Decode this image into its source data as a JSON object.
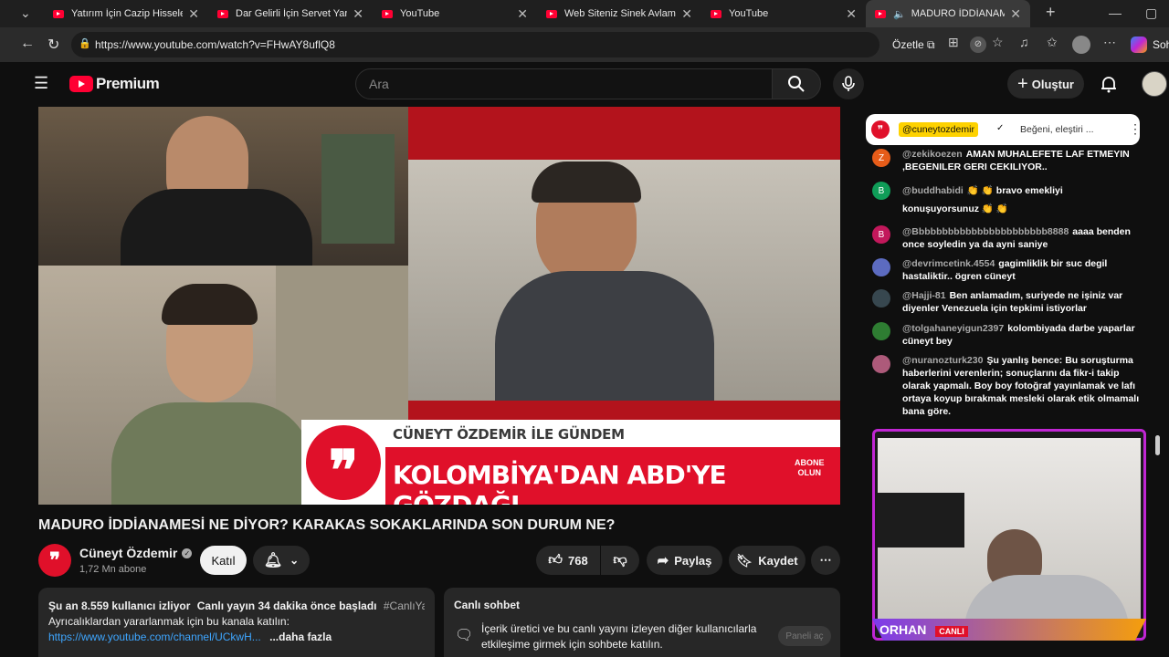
{
  "browser": {
    "tabs": [
      {
        "title": "Yatırım İçin Cazip Hisseler Oc"
      },
      {
        "title": "Dar Gelirli İçin Servet Yaratma"
      },
      {
        "title": "YouTube"
      },
      {
        "title": "Web Siteniz Sinek Avlamasını"
      },
      {
        "title": "YouTube"
      },
      {
        "title": "MADURO İDDİANAMESİ"
      }
    ],
    "url": "https://www.youtube.com/watch?v=FHwAY8uflQ8",
    "summarize_label": "Özetle",
    "copilot_label": "Soh"
  },
  "youtube": {
    "logo_text": "Premium",
    "search_placeholder": "Ara",
    "create_label": "Oluştur"
  },
  "video": {
    "show_name": "CÜNEYT ÖZDEMİR İLE GÜNDEM",
    "headline": "KOLOMBİYA'DAN ABD'YE GÖZDAĞI",
    "subscribe_badge_line1": "ABONE",
    "subscribe_badge_line2": "OLUN",
    "title": "MADURO İDDİANAMESİ NE DİYOR? KARAKAS SOKAKLARINDA SON DURUM NE?"
  },
  "channel": {
    "name": "Cüneyt Özdemir",
    "subscribers": "1,72 Mn abone",
    "join_label": "Katıl"
  },
  "actions": {
    "likes": "768",
    "share_label": "Paylaş",
    "save_label": "Kaydet"
  },
  "description": {
    "viewers": "Şu an 8.559 kullanıcı izliyor",
    "started": "Canlı yayın 34 dakika önce başladı",
    "hashtag": "#CanlıYayın",
    "line2": "Ayrıcalıklardan yararlanmak için bu kanala katılın:",
    "link": "https://www.youtube.com/channel/UCkwH...",
    "more": "...daha fazla"
  },
  "live_chat_box": {
    "title": "Canlı sohbet",
    "text": "İçerik üretici ve bu canlı yayını izleyen diğer kullanıcılarla etkileşime girmek için sohbete katılın.",
    "open_panel": "Paneli aç"
  },
  "chat": {
    "pinned_handle": "@cuneytozdemir",
    "pinned_text": "Beğeni, eleştiri ...",
    "messages": [
      {
        "initial": "Z",
        "color": "#e65c19",
        "author": "@zekikoezen",
        "text": "AMAN MUHALEFETE LAF ETMEYIN ,BEGENILER GERI CEKILIYOR.."
      },
      {
        "initial": "B",
        "color": "#0f9d58",
        "author": "@buddhabidi",
        "text": "👏 👏 bravo emekliyi konuşuyorsunuz 👏 👏"
      },
      {
        "initial": "B",
        "color": "#c2185b",
        "author": "@Bbbbbbbbbbbbbbbbbbbbbbb8888",
        "text": "aaaa benden once soyledin ya da ayni saniye"
      },
      {
        "initial": "",
        "color": "#5c6bc0",
        "author": "@devrimcetink.4554",
        "text": "gagimliklik bir suc degil hastaliktir.. ögren cüneyt"
      },
      {
        "initial": "",
        "color": "#37474f",
        "author": "@Hajji-81",
        "text": "Ben anlamadım, suriyede ne işiniz var diyenler Venezuela için tepkimi istiyorlar"
      },
      {
        "initial": "",
        "color": "#2e7d32",
        "author": "@tolgahaneyigun2397",
        "text": "kolombiyada darbe yaparlar cüneyt bey"
      },
      {
        "initial": "",
        "color": "#ad5a7a",
        "author": "@nuranozturk230",
        "text": "Şu yanlış bence: Bu soruşturma haberlerini verenlerin; sonuçlarını da fikr-i takip olarak yapmalı. Boy boy fotoğraf yayınlamak ve lafı ortaya koyup bırakmak mesleki olarak etik olmamalı bana göre."
      }
    ]
  },
  "overlay": {
    "bottom_text": "ORHAN",
    "live_badge": "CANLI"
  }
}
